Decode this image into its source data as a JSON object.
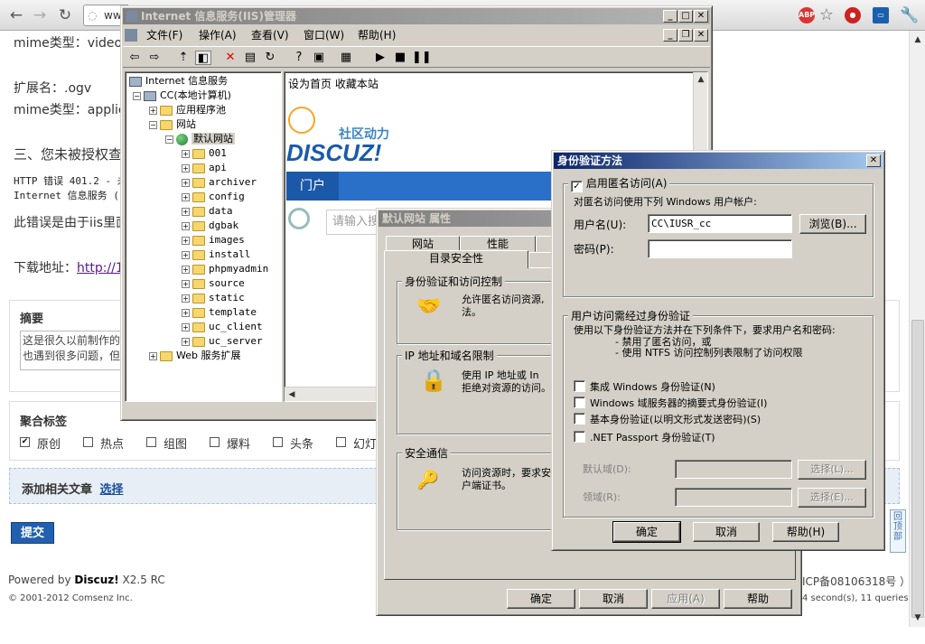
{
  "browser": {
    "url_fragment": "ww"
  },
  "webpage": {
    "line_mime_video": "mime类型：video/r",
    "line_ext": "扩展名：.ogv",
    "line_mime_app": "mime类型：applica",
    "heading_three": "三、您未被授权查",
    "line_http_error": "HTTP 错误 401.2 - 未",
    "line_iis_service": "Internet 信息服务 (",
    "line_error_cause": "此错误是由于iis里面",
    "line_download": "下载地址：",
    "download_link": "http://1",
    "summary_label": "摘要",
    "summary_text_1": "这是很久以前制作的",
    "summary_text_2": "也遇到很多问题，但",
    "tags_label": "聚合标签",
    "tags": [
      "原创",
      "热点",
      "组图",
      "爆料",
      "头条",
      "幻灯"
    ],
    "related_label": "添加相关文章",
    "related_link": "选择",
    "submit_label": "提交",
    "powered_prefix": "Powered by ",
    "powered_brand": "Discuz!",
    "powered_version": " X2.5 RC",
    "copyright": "© 2001-2012 Comsenz Inc.",
    "icp": "ICP备08106318号 ）",
    "stats": "4 second(s), 11 queries .",
    "back_to_top": "回顶部"
  },
  "iis_window": {
    "title": "Internet 信息服务(IIS)管理器",
    "menu": [
      "文件(F)",
      "操作(A)",
      "查看(V)",
      "窗口(W)",
      "帮助(H)"
    ],
    "tree": {
      "root": "Internet 信息服务",
      "computer": "CC(本地计算机)",
      "app_pools": "应用程序池",
      "websites": "网站",
      "default_site": "默认网站",
      "folders": [
        "001",
        "api",
        "archiver",
        "config",
        "data",
        "dgbak",
        "images",
        "install",
        "phpmyadmin",
        "source",
        "static",
        "template",
        "uc_client",
        "uc_server"
      ],
      "web_ext": "Web 服务扩展"
    },
    "preview": {
      "links": "设为首页  收藏本站",
      "brand_sub": "社区动力",
      "brand": "DISCUZ!",
      "nav": "门户",
      "search_placeholder": "请输入搜"
    }
  },
  "props_dialog": {
    "title": "默认网站 属性",
    "tabs_row1": [
      "网站",
      "性能"
    ],
    "tab_active": "目录安全性",
    "auth_group": "身份验证和访问控制",
    "auth_desc": "允许匿名访问资源,",
    "auth_desc2": "法。",
    "ip_group": "IP 地址和域名限制",
    "ip_desc": "使用 IP 地址或 In",
    "ip_desc2": "拒绝对资源的访问。",
    "secure_group": "安全通信",
    "secure_desc": "访问资源时，要求安",
    "secure_desc2": "户端证书。",
    "ok": "确定",
    "cancel": "取消",
    "apply": "应用(A)",
    "help": "帮助"
  },
  "auth_dialog": {
    "title": "身份验证方法",
    "anon_checkbox": "启用匿名访问(A)",
    "anon_desc": "对匿名访问使用下列 Windows 用户帐户:",
    "username_label": "用户名(U):",
    "username_value": "CC\\IUSR_cc",
    "browse": "浏览(B)...",
    "password_label": "密码(P):",
    "password_value": "",
    "auth_group": "用户访问需经过身份验证",
    "auth_desc1": "使用以下身份验证方法并在下列条件下，要求用户名和密码:",
    "auth_desc2": "- 禁用了匿名访问，或",
    "auth_desc3": "- 使用 NTFS 访问控制列表限制了访问权限",
    "methods": [
      "集成 Windows 身份验证(N)",
      "Windows 域服务器的摘要式身份验证(I)",
      "基本身份验证(以明文形式发送密码)(S)",
      ".NET Passport 身份验证(T)"
    ],
    "default_domain_label": "默认域(D):",
    "realm_label": "领域(R):",
    "select1": "选择(L)...",
    "select2": "选择(E)...",
    "ok": "确定",
    "cancel": "取消",
    "help": "帮助(H)"
  }
}
